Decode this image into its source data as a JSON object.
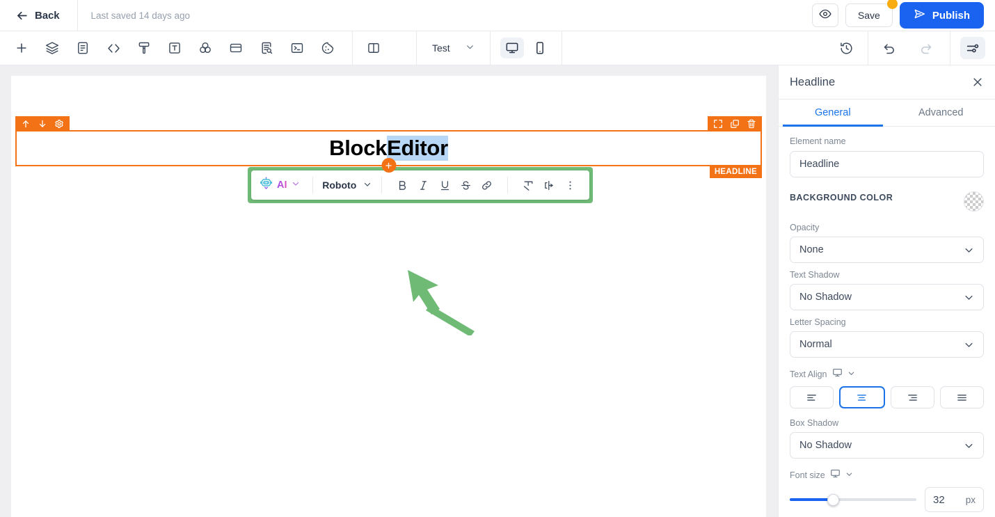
{
  "topbar": {
    "back_label": "Back",
    "back_icon": "arrow-left-icon",
    "saved_text": "Last saved 14 days ago",
    "preview_icon": "eye-icon",
    "save_label": "Save",
    "save_badge": "unsaved-changes-dot",
    "publish_label": "Publish",
    "publish_icon": "send-icon",
    "publish_color": "#1a62f0",
    "badge_color": "#f9ab12"
  },
  "toolbar": {
    "items": [
      {
        "name": "add-element-icon",
        "title": "Add"
      },
      {
        "name": "layers-icon",
        "title": "Layers"
      },
      {
        "name": "page-icon",
        "title": "Pages"
      },
      {
        "name": "code-icon",
        "title": "Code"
      },
      {
        "name": "paint-brush-icon",
        "title": "Styles"
      },
      {
        "name": "text-box-icon",
        "title": "Text"
      },
      {
        "name": "color-blend-icon",
        "title": "Colors"
      },
      {
        "name": "container-icon",
        "title": "Containers"
      },
      {
        "name": "document-search-icon",
        "title": "SEO"
      },
      {
        "name": "terminal-icon",
        "title": "Console"
      },
      {
        "name": "cookie-icon",
        "title": "Cookies"
      }
    ],
    "split_view_icon": "split-panel-icon",
    "test_label": "Test",
    "test_chevron_icon": "chevron-down-icon",
    "devices": [
      {
        "name": "desktop-icon",
        "label": "Desktop",
        "active": true
      },
      {
        "name": "mobile-icon",
        "label": "Mobile",
        "active": false
      }
    ],
    "history_icon": "history-clock-icon",
    "undo_icon": "undo-icon",
    "redo_icon": "redo-icon",
    "redo_disabled": true,
    "settings_icon": "sliders-icon",
    "settings_active": true
  },
  "canvas": {
    "block": {
      "type_badge": "HEADLINE",
      "accent_color": "#f47216",
      "text_before": "Block ",
      "text_selected": "Editor",
      "selection_color": "#b8d7f7",
      "left_controls": [
        {
          "name": "move-up-icon"
        },
        {
          "name": "move-down-icon"
        },
        {
          "name": "block-settings-gear-icon"
        }
      ],
      "right_controls": [
        {
          "name": "expand-icon"
        },
        {
          "name": "duplicate-icon"
        },
        {
          "name": "delete-trash-icon"
        }
      ],
      "add_below_icon": "plus-circle-icon"
    },
    "format_toolbar": {
      "highlight_color": "#6fbb76",
      "ai_label": "AI",
      "ai_icon": "robot-icon",
      "ai_chevron_icon": "chevron-down-icon",
      "font_label": "Roboto",
      "font_chevron_icon": "chevron-down-icon",
      "buttons": [
        {
          "name": "bold-icon",
          "label": "B"
        },
        {
          "name": "italic-icon",
          "label": "I"
        },
        {
          "name": "underline-icon",
          "label": "U"
        },
        {
          "name": "strikethrough-icon",
          "label": "S"
        },
        {
          "name": "link-icon",
          "label": "Link"
        },
        {
          "name": "clear-formatting-icon",
          "label": "Clear formatting"
        },
        {
          "name": "text-direction-icon",
          "label": "Text direction"
        },
        {
          "name": "more-options-icon",
          "label": "More"
        }
      ]
    },
    "annotation": {
      "name": "green-pointer-arrow",
      "color": "#6fbb76"
    }
  },
  "panel": {
    "title": "Headline",
    "close_icon": "close-icon",
    "tabs": [
      {
        "label": "General",
        "active": true
      },
      {
        "label": "Advanced",
        "active": false
      }
    ],
    "element_name": {
      "label": "Element name",
      "value": "Headline"
    },
    "background_color": {
      "label": "BACKGROUND COLOR",
      "swatch": "transparent-checkerboard"
    },
    "fields": [
      {
        "label": "Opacity",
        "value": "None"
      },
      {
        "label": "Text Shadow",
        "value": "No Shadow"
      },
      {
        "label": "Letter Spacing",
        "value": "Normal"
      }
    ],
    "text_align": {
      "label": "Text Align",
      "device_icon": "desktop-icon",
      "chevron_icon": "chevron-down-icon",
      "options": [
        {
          "name": "align-left-icon",
          "active": false
        },
        {
          "name": "align-center-icon",
          "active": true
        },
        {
          "name": "align-right-icon",
          "active": false
        },
        {
          "name": "align-justify-icon",
          "active": false
        }
      ]
    },
    "box_shadow": {
      "label": "Box Shadow",
      "value": "No Shadow"
    },
    "font_size": {
      "label": "Font size",
      "device_icon": "desktop-icon",
      "chevron_icon": "chevron-down-icon",
      "value": "32",
      "unit": "px"
    },
    "accent_color": "#1a73e8"
  }
}
